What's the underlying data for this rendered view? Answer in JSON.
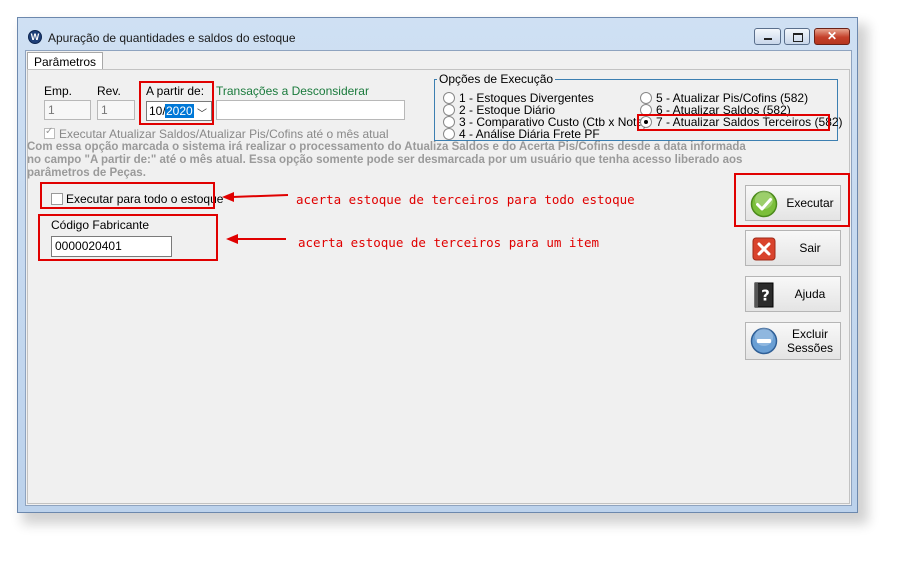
{
  "window": {
    "title": "Apuração de quantidades e saldos do estoque"
  },
  "tabs": [
    {
      "label": "Parâmetros"
    }
  ],
  "form": {
    "emp_label": "Emp.",
    "emp_value": "1",
    "rev_label": "Rev.",
    "rev_value": "1",
    "a_partir_label": "A partir de:",
    "a_partir_month": "10/",
    "a_partir_year": "2020",
    "transacoes_label": "Transações a Desconsiderar",
    "executar_atualizar_label": "Executar Atualizar Saldos/Atualizar Pis/Cofins até o mês atual",
    "note": "Com essa opção marcada o sistema irá realizar o processamento do Atualiza Saldos e do Acerta Pis/Cofins desde a data informada no campo \"A partir de:\" até o mês atual. Essa opção somente pode ser desmarcada por um usuário que tenha acesso liberado aos parâmetros de Peças.",
    "executar_todo_estoque_label": "Executar para todo o estoque",
    "codigo_fabricante_label": "Código Fabricante",
    "codigo_fabricante_value": "0000020401"
  },
  "opcoes": {
    "title": "Opções de Execução",
    "items": [
      {
        "label": "1 - Estoques Divergentes",
        "selected": false
      },
      {
        "label": "2 - Estoque Diário",
        "selected": false
      },
      {
        "label": "3 - Comparativo Custo (Ctb x Nota)",
        "selected": false
      },
      {
        "label": "4 - Análise Diária Frete PF",
        "selected": false
      },
      {
        "label": "5 - Atualizar Pis/Cofins (582)",
        "selected": false
      },
      {
        "label": "6 - Atualizar Saldos (582)",
        "selected": false
      },
      {
        "label": "7 - Atualizar Saldos Terceiros (582)",
        "selected": true
      }
    ]
  },
  "buttons": {
    "executar": "Executar",
    "sair": "Sair",
    "ajuda": "Ajuda",
    "excluir": "Excluir Sessões"
  },
  "annotations": {
    "todo_estoque": "acerta estoque de terceiros para todo estoque",
    "um_item": "acerta estoque de terceiros para um item"
  },
  "colors": {
    "highlight": "#e00000",
    "link": "#1a7a3c",
    "selection": "#0078d7"
  }
}
